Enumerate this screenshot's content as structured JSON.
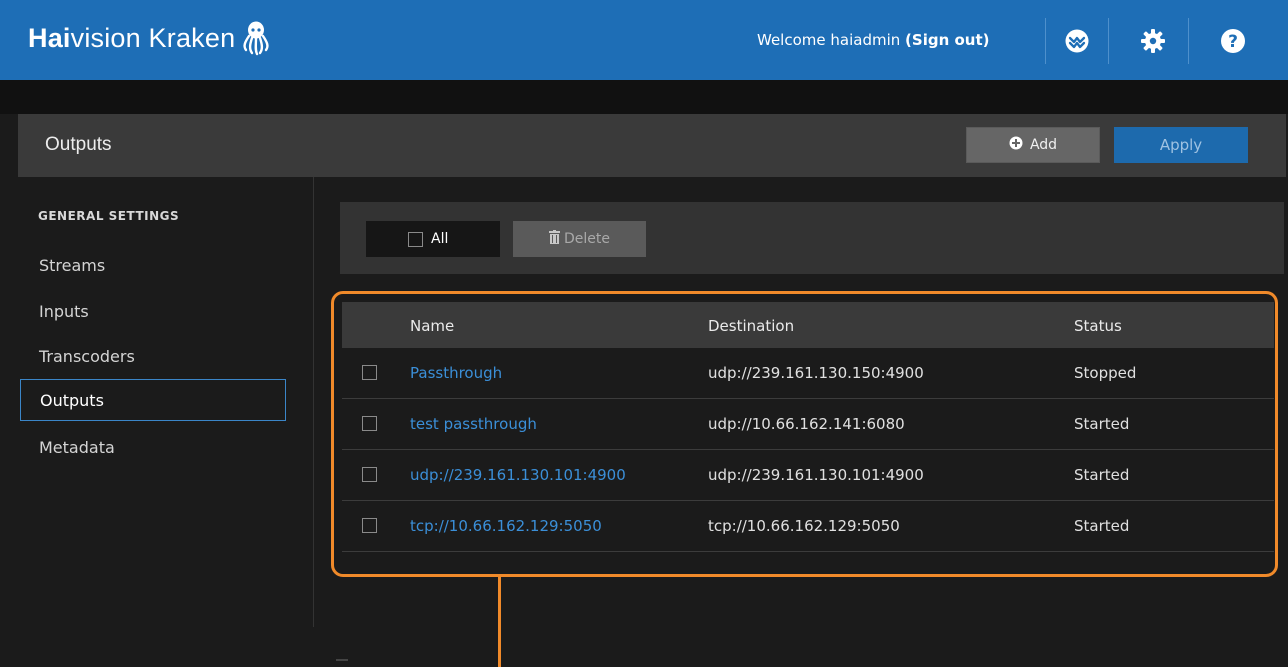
{
  "app": {
    "brand_bold": "Hai",
    "brand_light": "vision Kraken",
    "welcome_text": "Welcome haiadmin",
    "signout_label": "(Sign out)"
  },
  "icons": {
    "logo": "octopus-logo-icon",
    "status": "status-icon",
    "settings": "gear-icon",
    "help": "help-icon",
    "add": "plus-circle-icon",
    "delete": "trash-icon"
  },
  "colors": {
    "topbar": "#1e6eb6",
    "accent": "#1d6aad",
    "link": "#3b8fd8",
    "highlight": "#f08a2a"
  },
  "header": {
    "title": "Outputs",
    "add_label": "Add",
    "apply_label": "Apply"
  },
  "sidebar": {
    "heading": "GENERAL SETTINGS",
    "items": [
      {
        "label": "Streams"
      },
      {
        "label": "Inputs"
      },
      {
        "label": "Transcoders"
      },
      {
        "label": "Outputs",
        "active": true
      },
      {
        "label": "Metadata"
      }
    ]
  },
  "toolbar": {
    "all_label": "All",
    "delete_label": "Delete"
  },
  "table": {
    "columns": [
      "Name",
      "Destination",
      "Status"
    ],
    "rows": [
      {
        "name": "Passthrough",
        "destination": "udp://239.161.130.150:4900",
        "status": "Stopped"
      },
      {
        "name": "test passthrough",
        "destination": "udp://10.66.162.141:6080",
        "status": "Started"
      },
      {
        "name": "udp://239.161.130.101:4900",
        "destination": "udp://239.161.130.101:4900",
        "status": "Started"
      },
      {
        "name": "tcp://10.66.162.129:5050",
        "destination": "tcp://10.66.162.129:5050",
        "status": "Started"
      }
    ]
  }
}
